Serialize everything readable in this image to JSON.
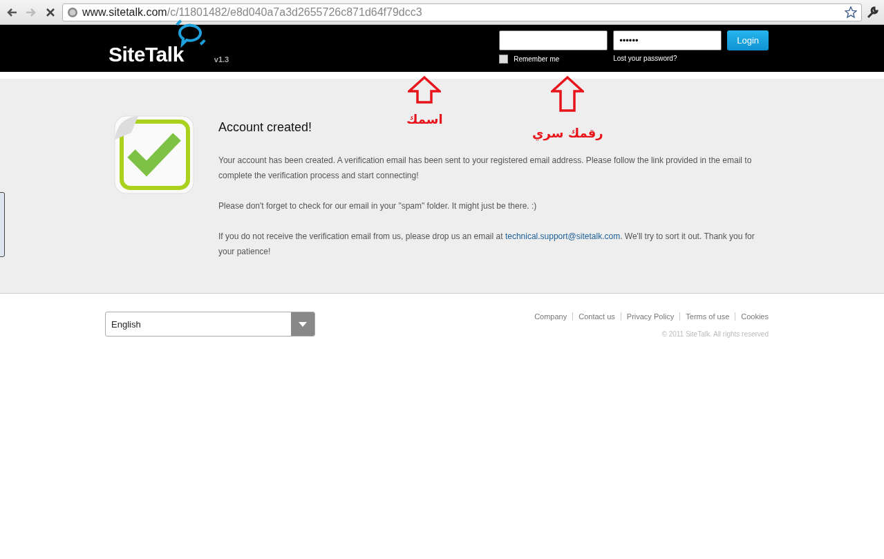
{
  "browser": {
    "url_host": "www.sitetalk.com",
    "url_path": "/c/11801482/e8d040a7a3d2655726c871d64f79dcc3",
    "loading": true
  },
  "header": {
    "logo": "SiteTalk",
    "version": "v1.3",
    "password": {
      "value": "••••••"
    },
    "login_button": "Login",
    "remember": {
      "label": "Remember me",
      "checked": false
    },
    "lost_password": "Lost your password?"
  },
  "annotations": [
    {
      "kind": "arrow",
      "label": "اسمك",
      "color": "#e8141c"
    },
    {
      "kind": "arrow",
      "label": "رقمك سري",
      "color": "#e8141c"
    }
  ],
  "message": {
    "title": "Account created!",
    "paragraphs": [
      {
        "text": "Your account has been created. A verification email has been sent to your registered email address. Please follow the link provided in the email to complete the verification process and start connecting!"
      },
      {
        "text": "Please don't forget to check for our email in your \"spam\" folder. It might just be there. :)"
      },
      {
        "text": "If you do not receive the verification email from us, please drop us an email at ",
        "link": "technical.support@sitetalk.com",
        "after": ". We'll try to sort it out. Thank you for your patience!"
      }
    ]
  },
  "footer": {
    "language": "English",
    "links": [
      "Company",
      "Contact us",
      "Privacy Policy",
      "Terms of use",
      "Cookies"
    ],
    "copyright": "© 2011 SiteTalk. All rights reserved"
  }
}
